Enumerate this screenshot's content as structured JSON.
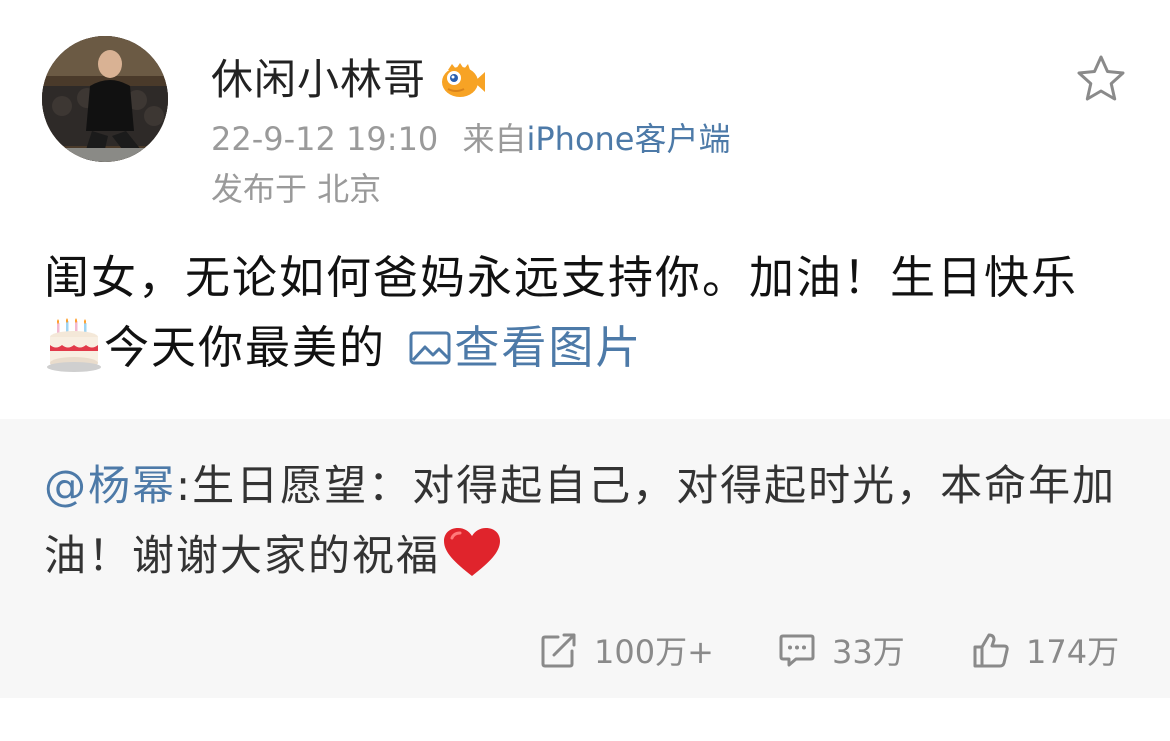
{
  "post": {
    "author": "休闲小林哥",
    "timestamp": "22-9-12 19:10",
    "source_prefix": "来自",
    "source": "iPhone客户端",
    "location": "发布于 北京",
    "text_part1": "闺女，无论如何爸妈永远支持你。加油！生日快乐",
    "text_part2": "今天你最美的",
    "view_pictures": "查看图片"
  },
  "repost": {
    "mention": "@杨幂",
    "text": ":生日愿望：对得起自己，对得起时光，本命年加油！谢谢大家的祝福"
  },
  "actions": {
    "repost_count": "100万+",
    "comment_count": "33万",
    "like_count": "174万"
  },
  "icons": {
    "vip": "fish-vip-badge-icon",
    "favorite": "star-outline-icon",
    "picture": "picture-icon",
    "repost": "repost-icon",
    "comment": "comment-icon",
    "like": "thumbs-up-icon",
    "cake": "birthday-cake-emoji",
    "heart": "red-heart-emoji"
  },
  "colors": {
    "link": "#4d7aa8",
    "meta": "#9a9a9a",
    "repost_bg": "#f7f7f7"
  }
}
